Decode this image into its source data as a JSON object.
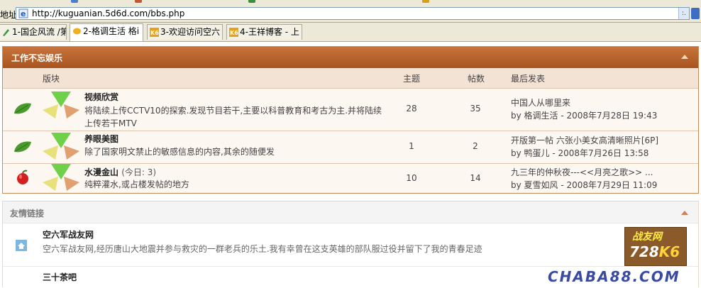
{
  "browser": {
    "address_label": "地址",
    "url": "http://kuguanian.5d6d.com/bbs.php",
    "dropdown_glyph": ":.",
    "tabs": [
      {
        "label": "1-国企风流 /第"
      },
      {
        "label": "2-格调生活 格i"
      },
      {
        "label": "3-欢迎访问空六"
      },
      {
        "label": "4-王祥博客 - 上"
      }
    ]
  },
  "category": {
    "title": "工作不忘娱乐",
    "columns": {
      "board": "版块",
      "topics": "主题",
      "posts": "帖数",
      "last_post": "最后发表"
    },
    "forums": [
      {
        "name": "视频欣赏",
        "today": "",
        "description": "将陆续上传CCTV10的探索.发现节目若干,主要以科普教育和考古为主.并将陆续上传若干MTV",
        "topics": "28",
        "posts": "35",
        "last_title": "中国人从哪里来",
        "last_by": "by 格调生活",
        "last_time": "- 2008年7月28日  19:43",
        "status_icon": "leaf-icon"
      },
      {
        "name": "养眼美图",
        "today": "",
        "description": "除了国家明文禁止的敏感信息的内容,其余的随便发",
        "topics": "1",
        "posts": "2",
        "last_title": "开版第一帖  六张小美女高清晰照片[6P]",
        "last_by": "by 鸭蛋儿",
        "last_time": "- 2008年7月26日  13:58",
        "status_icon": "leaf-icon"
      },
      {
        "name": "水漫金山",
        "today": "(今日: 3)",
        "description": "纯粹灌水,或占楼发帖的地方",
        "topics": "10",
        "posts": "14",
        "last_title": "九三年的仲秋夜---<<月亮之歌>> ...",
        "last_by": "by 夏雪如风",
        "last_time": "- 2008年7月29日  11:09",
        "status_icon": "apple-icon"
      }
    ]
  },
  "friend_links": {
    "title": "友情链接",
    "items": [
      {
        "name": "空六军战友网",
        "description": "空六军战友网,经历唐山大地震并参与救灾的一群老兵的乐土.我有幸曾在这支英雄的部队服过役并留下了我的青春足迹"
      },
      {
        "name": "三十茶吧",
        "description": ""
      }
    ],
    "banner_line1": "战友网",
    "banner_line2a": "728",
    "banner_line2b": "K6",
    "watermark": "CHABA88.COM"
  },
  "colors": {
    "header_brown": "#b25f27",
    "row_bg": "#fdf7f2",
    "accent_leaf": "#4a9b2e",
    "apple_red": "#d21f1f"
  }
}
